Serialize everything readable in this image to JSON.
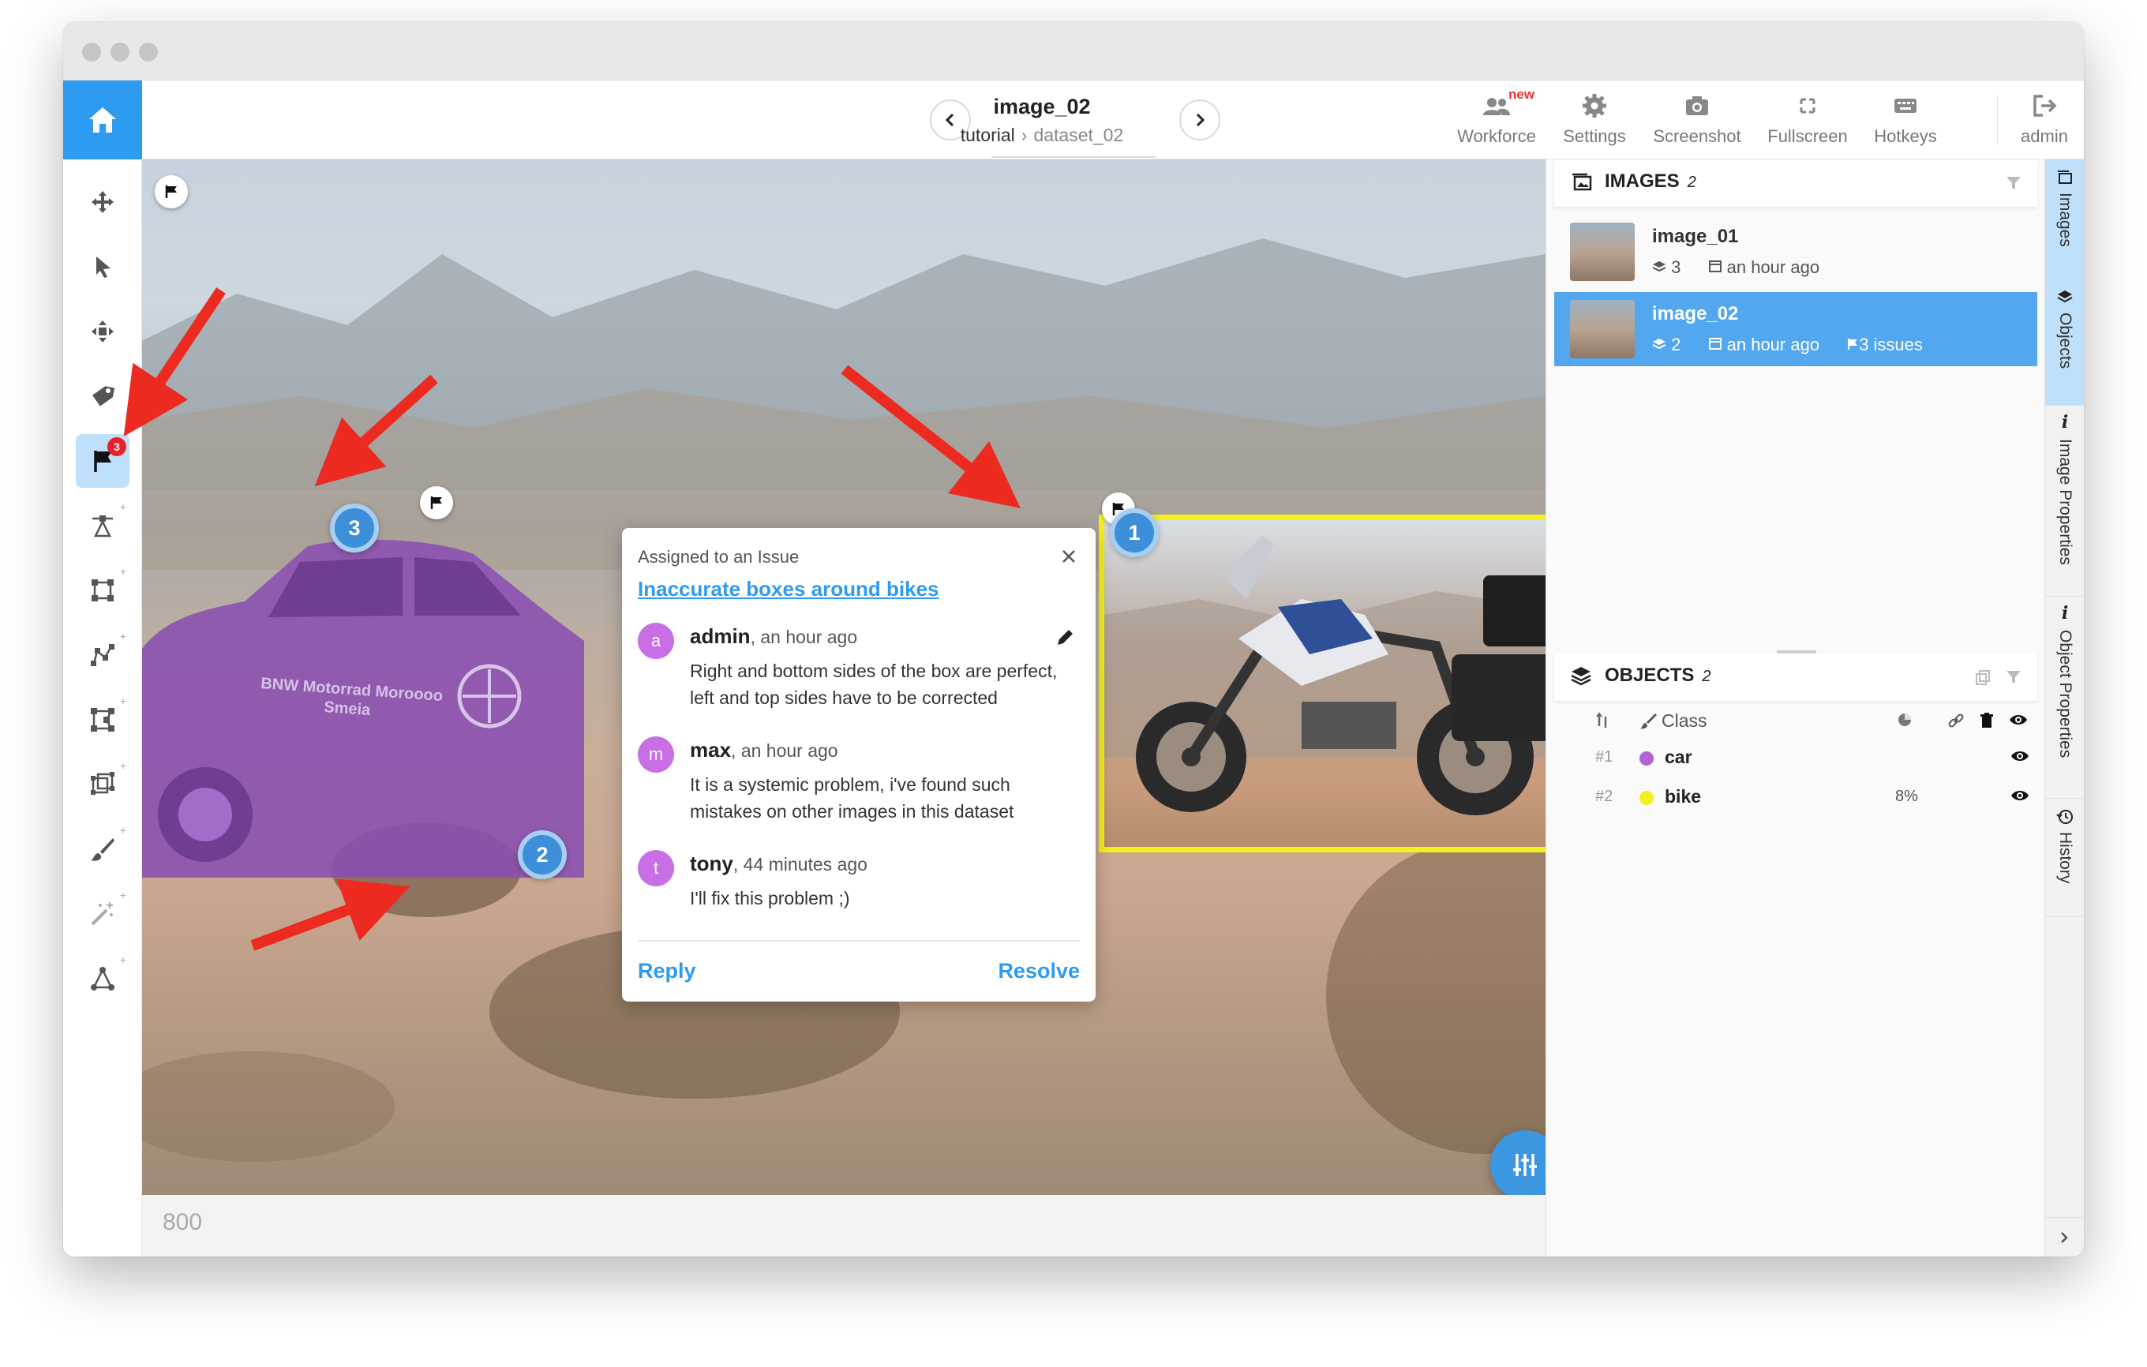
{
  "header": {
    "image_title": "image_02",
    "breadcrumb_project": "tutorial",
    "breadcrumb_sep": "›",
    "breadcrumb_dataset": "dataset_02",
    "toolbar": [
      {
        "label": "Workforce",
        "icon": "workforce-icon",
        "tag": "new"
      },
      {
        "label": "Settings",
        "icon": "gear-icon"
      },
      {
        "label": "Screenshot",
        "icon": "camera-icon"
      },
      {
        "label": "Fullscreen",
        "icon": "fullscreen-icon"
      },
      {
        "label": "Hotkeys",
        "icon": "keyboard-icon"
      },
      {
        "label": "admin",
        "icon": "logout-icon"
      }
    ]
  },
  "tools": [
    {
      "name": "move-tool",
      "icon": "move-icon"
    },
    {
      "name": "select-tool",
      "icon": "cursor-icon"
    },
    {
      "name": "drag-tool",
      "icon": "drag-icon"
    },
    {
      "name": "tag-tool",
      "icon": "tag-icon"
    },
    {
      "name": "issues-tool",
      "icon": "flag-icon",
      "badge": "3",
      "active": true
    },
    {
      "name": "point-tool",
      "icon": "point-icon"
    },
    {
      "name": "rectangle-tool",
      "icon": "rectangle-icon"
    },
    {
      "name": "polyline-tool",
      "icon": "polyline-icon"
    },
    {
      "name": "polygon-tool",
      "icon": "polygon-icon"
    },
    {
      "name": "cuboid-tool",
      "icon": "cuboid-icon"
    },
    {
      "name": "brush-tool",
      "icon": "brush-icon"
    },
    {
      "name": "smart-tool",
      "icon": "magic-wand-icon"
    },
    {
      "name": "graph-tool",
      "icon": "graph-icon"
    }
  ],
  "canvas": {
    "zoom_label": "800",
    "markers": [
      "1",
      "2",
      "3"
    ],
    "car_text_line1": "BNW Motorrad Moroooo",
    "car_text_line2": "Smeia"
  },
  "issue_popup": {
    "header": "Assigned to an Issue",
    "title": "Inaccurate boxes around bikes",
    "comments": [
      {
        "initial": "a",
        "author": "admin",
        "time": ", an hour ago",
        "text": "Right and bottom sides of the box are perfect, left and top sides have to be corrected"
      },
      {
        "initial": "m",
        "author": "max",
        "time": ", an hour ago",
        "text": "It is a systemic problem, i've found such mistakes on other images in this dataset"
      },
      {
        "initial": "t",
        "author": "tony",
        "time": ", 44 minutes ago",
        "text": "I'll fix this problem ;)"
      }
    ],
    "reply_label": "Reply",
    "resolve_label": "Resolve"
  },
  "images_panel": {
    "title": "IMAGES",
    "count": "2",
    "items": [
      {
        "name": "image_01",
        "objects": "3",
        "time": "an hour ago",
        "issues": ""
      },
      {
        "name": "image_02",
        "objects": "2",
        "time": "an hour ago",
        "issues": "3 issues",
        "selected": true
      }
    ]
  },
  "objects_panel": {
    "title": "OBJECTS",
    "count": "2",
    "class_header": "Class",
    "items": [
      {
        "num": "#1",
        "class": "car",
        "color": "#b561d8",
        "pct": ""
      },
      {
        "num": "#2",
        "class": "bike",
        "color": "#f3f01c",
        "pct": "8%"
      }
    ]
  },
  "side_tabs": [
    "Images",
    "Objects",
    "Image Properties",
    "Object Properties",
    "History"
  ],
  "colors": {
    "accent": "#2d9bf0",
    "arrow": "#ec2a1f",
    "car_mask": "#8a4fb0",
    "bike_box": "#f3f01c",
    "badge": "#e8212b"
  }
}
